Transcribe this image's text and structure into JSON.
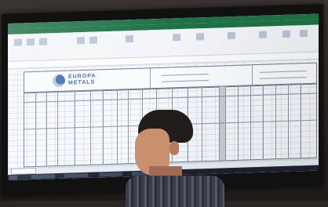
{
  "logo": {
    "line1": "EUROPA",
    "line2": "METALS"
  },
  "colors": {
    "excel_green": "#1f7246",
    "logo_blue": "#3b5f94"
  }
}
